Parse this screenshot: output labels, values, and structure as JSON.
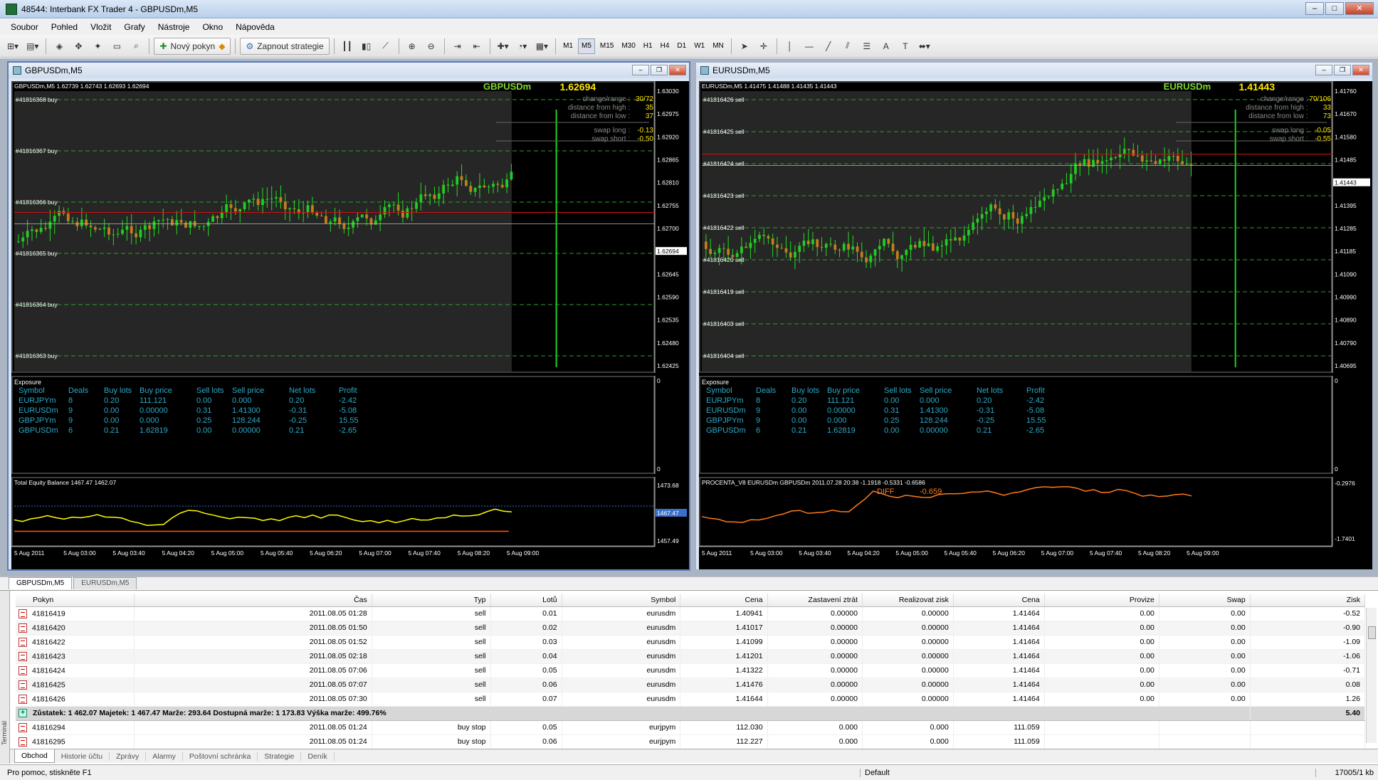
{
  "window": {
    "title": "48544: Interbank FX Trader 4 - GBPUSDm,M5"
  },
  "menu": [
    "Soubor",
    "Pohled",
    "Vložit",
    "Grafy",
    "Nástroje",
    "Okno",
    "Nápověda"
  ],
  "toolbar": {
    "new_order": "Nový pokyn",
    "strategies": "Zapnout strategie",
    "timeframes": [
      "M1",
      "M5",
      "M15",
      "M30",
      "H1",
      "H4",
      "D1",
      "W1",
      "MN"
    ],
    "active_tf": "M5"
  },
  "charts": [
    {
      "title": "GBPUSDm,M5",
      "header": "GBPUSDm,M5  1.62739 1.62743 1.62693 1.62694",
      "symbol": "GBPUSDm",
      "price": "1.62694",
      "info": [
        [
          "change/range :",
          "30/72"
        ],
        [
          "distance from high :",
          "35"
        ],
        [
          "distance from low :",
          "37"
        ],
        [
          "swap long :",
          "-0.13"
        ],
        [
          "swap short :",
          "-0.50"
        ]
      ],
      "orders": [
        "#41816368 buy",
        "#41816367 buy",
        "#41816366 buy",
        "#41816365 buy",
        "#41816364 buy",
        "#41816363 buy"
      ],
      "price_scale": [
        "1.63030",
        "1.62975",
        "1.62920",
        "1.62865",
        "1.62810",
        "1.62755",
        "1.62700",
        "1.62694",
        "1.62645",
        "1.62590",
        "1.62535",
        "1.62480",
        "1.62425"
      ],
      "exposure": {
        "title": "Exposure",
        "headers": [
          "Symbol",
          "Deals",
          "Buy lots",
          "Buy price",
          "Sell lots",
          "Sell price",
          "Net lots",
          "Profit"
        ],
        "rows": [
          [
            "EURJPYm",
            "8",
            "0.20",
            "111.121",
            "0.00",
            "0.000",
            "0.20",
            "-2.42"
          ],
          [
            "EURUSDm",
            "9",
            "0.00",
            "0.00000",
            "0.31",
            "1.41300",
            "-0.31",
            "-5.08"
          ],
          [
            "GBPJPYm",
            "9",
            "0.00",
            "0.000",
            "0.25",
            "128.244",
            "-0.25",
            "15.55"
          ],
          [
            "GBPUSDm",
            "6",
            "0.21",
            "1.62819",
            "0.00",
            "0.00000",
            "0.21",
            "-2.65"
          ]
        ],
        "scale_top": "0",
        "scale_bottom": "0"
      },
      "indicator": {
        "label": "Total Equity Balance 1467.47 1462.07",
        "scale": [
          "1473.68",
          "1467.47",
          "1457.49"
        ]
      },
      "time_axis": [
        "5 Aug 2011",
        "5 Aug 03:00",
        "5 Aug 03:40",
        "5 Aug 04:20",
        "5 Aug 05:00",
        "5 Aug 05:40",
        "5 Aug 06:20",
        "5 Aug 07:00",
        "5 Aug 07:40",
        "5 Aug 08:20",
        "5 Aug 09:00"
      ]
    },
    {
      "title": "EURUSDm,M5",
      "header": "EURUSDm,M5  1.41475 1.41488 1.41435 1.41443",
      "symbol": "EURUSDm",
      "price": "1.41443",
      "info": [
        [
          "change/range :",
          "70/106"
        ],
        [
          "distance from high :",
          "33"
        ],
        [
          "distance from low :",
          "73"
        ],
        [
          "swap long :",
          "-0.05"
        ],
        [
          "swap short :",
          "-0.55"
        ]
      ],
      "orders": [
        "#41816426 sell",
        "#41816425 sell",
        "#41816424 sell",
        "#41816423 sell",
        "#41816422 sell",
        "#41816420 sell",
        "#41816419 sell",
        "#41816403 sell",
        "#41816404 sell"
      ],
      "price_scale": [
        "1.41760",
        "1.41670",
        "1.41580",
        "1.41485",
        "1.41443",
        "1.41395",
        "1.41285",
        "1.41185",
        "1.41090",
        "1.40990",
        "1.40890",
        "1.40790",
        "1.40695"
      ],
      "exposure": {
        "title": "Exposure",
        "headers": [
          "Symbol",
          "Deals",
          "Buy lots",
          "Buy price",
          "Sell lots",
          "Sell price",
          "Net lots",
          "Profit"
        ],
        "rows": [
          [
            "EURJPYm",
            "8",
            "0.20",
            "111.121",
            "0.00",
            "0.000",
            "0.20",
            "-2.42"
          ],
          [
            "EURUSDm",
            "9",
            "0.00",
            "0.00000",
            "0.31",
            "1.41300",
            "-0.31",
            "-5.08"
          ],
          [
            "GBPJPYm",
            "9",
            "0.00",
            "0.000",
            "0.25",
            "128.244",
            "-0.25",
            "15.55"
          ],
          [
            "GBPUSDm",
            "6",
            "0.21",
            "1.62819",
            "0.00",
            "0.00000",
            "0.21",
            "-2.65"
          ]
        ],
        "scale_top": "0",
        "scale_bottom": "0"
      },
      "indicator": {
        "label": "PROCENTA_V8 EURUSDm GBPUSDm 2011.07.28 20:38  -1.1918 -0.5331 -0.6586",
        "sublabel": "DIFF",
        "subvalue": "-0.659",
        "scale": [
          "-0.2976",
          "-1.7401"
        ]
      },
      "time_axis": [
        "5 Aug 2011",
        "5 Aug 03:00",
        "5 Aug 03:40",
        "5 Aug 04:20",
        "5 Aug 05:00",
        "5 Aug 05:40",
        "5 Aug 06:20",
        "5 Aug 07:00",
        "5 Aug 07:40",
        "5 Aug 08:20",
        "5 Aug 09:00"
      ]
    }
  ],
  "chart_tabs": [
    "GBPUSDm,M5",
    "EURUSDm,M5"
  ],
  "orders_table": {
    "headers": [
      "Pokyn",
      "Čas",
      "Typ",
      "Lotů",
      "Symbol",
      "Cena",
      "Zastavení ztrát",
      "Realizovat zisk",
      "Cena",
      "Provize",
      "Swap",
      "Zisk"
    ],
    "rows": [
      [
        "41816419",
        "2011.08.05 01:28",
        "sell",
        "0.01",
        "eurusdm",
        "1.40941",
        "0.00000",
        "0.00000",
        "1.41464",
        "0.00",
        "0.00",
        "-0.52"
      ],
      [
        "41816420",
        "2011.08.05 01:50",
        "sell",
        "0.02",
        "eurusdm",
        "1.41017",
        "0.00000",
        "0.00000",
        "1.41464",
        "0.00",
        "0.00",
        "-0.90"
      ],
      [
        "41816422",
        "2011.08.05 01:52",
        "sell",
        "0.03",
        "eurusdm",
        "1.41099",
        "0.00000",
        "0.00000",
        "1.41464",
        "0.00",
        "0.00",
        "-1.09"
      ],
      [
        "41816423",
        "2011.08.05 02:18",
        "sell",
        "0.04",
        "eurusdm",
        "1.41201",
        "0.00000",
        "0.00000",
        "1.41464",
        "0.00",
        "0.00",
        "-1.06"
      ],
      [
        "41816424",
        "2011.08.05 07:06",
        "sell",
        "0.05",
        "eurusdm",
        "1.41322",
        "0.00000",
        "0.00000",
        "1.41464",
        "0.00",
        "0.00",
        "-0.71"
      ],
      [
        "41816425",
        "2011.08.05 07:07",
        "sell",
        "0.06",
        "eurusdm",
        "1.41476",
        "0.00000",
        "0.00000",
        "1.41464",
        "0.00",
        "0.00",
        "0.08"
      ],
      [
        "41816426",
        "2011.08.05 07:30",
        "sell",
        "0.07",
        "eurusdm",
        "1.41644",
        "0.00000",
        "0.00000",
        "1.41464",
        "0.00",
        "0.00",
        "1.26"
      ]
    ],
    "summary": {
      "text": "Zůstatek: 1 462.07  Majetek: 1 467.47  Marže: 293.64  Dostupná marže: 1 173.83  Výška marže: 499.76%",
      "value": "5.40"
    },
    "pending": [
      [
        "41816294",
        "2011.08.05 01:24",
        "buy stop",
        "0.05",
        "eurjpym",
        "112.030",
        "0.000",
        "0.000",
        "111.059",
        "",
        "",
        ""
      ],
      [
        "41816295",
        "2011.08.05 01:24",
        "buy stop",
        "0.06",
        "eurjpym",
        "112.227",
        "0.000",
        "0.000",
        "111.059",
        "",
        "",
        ""
      ]
    ]
  },
  "terminal_side": "Terminál",
  "terminal_tabs": [
    "Obchod",
    "Historie účtu",
    "Zprávy",
    "Alarmy",
    "Poštovní schránka",
    "Strategie",
    "Deník"
  ],
  "status": {
    "help": "Pro pomoc, stiskněte F1",
    "profile": "Default",
    "traffic": "17005/1 kb"
  }
}
